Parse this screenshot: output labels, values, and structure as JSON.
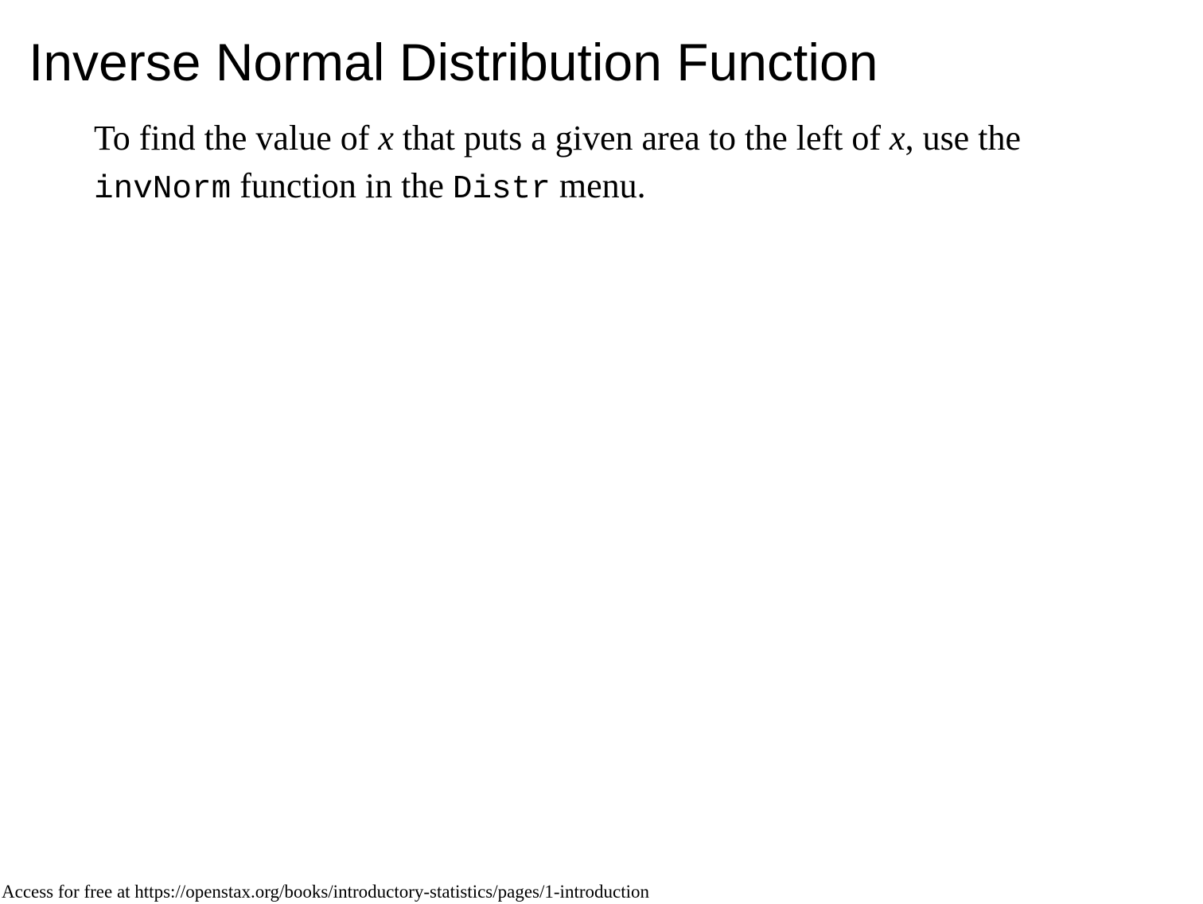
{
  "slide": {
    "title": "Inverse Normal Distribution Function",
    "body": {
      "text_1": "To find the value of ",
      "var_1": "x",
      "text_2": " that puts a given area to the left of ",
      "var_2": "x",
      "text_3": ", use the ",
      "code_1": "invNorm",
      "text_4": " function in the ",
      "code_2": "Distr",
      "text_5": " menu."
    }
  },
  "footer": {
    "text": "Access for free at https://openstax.org/books/introductory-statistics/pages/1-introduction"
  }
}
